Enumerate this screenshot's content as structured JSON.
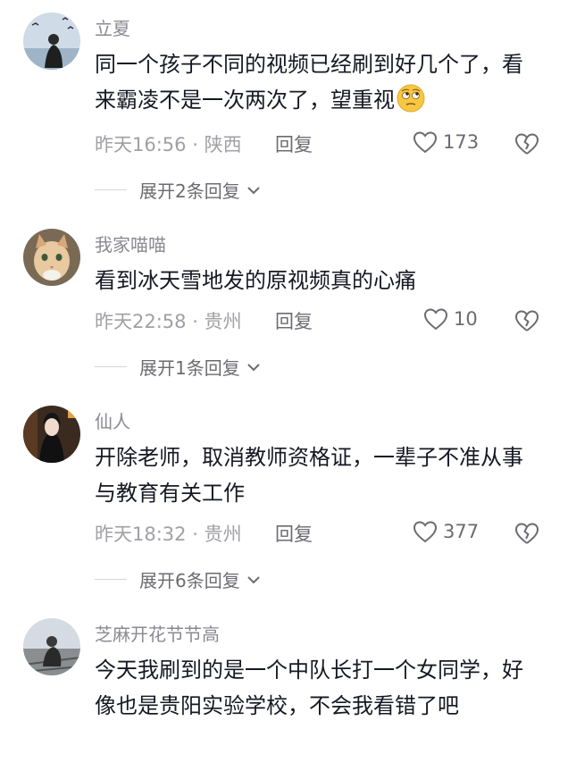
{
  "comments": [
    {
      "username": "立夏",
      "content": "同一个孩子不同的视频已经刷到好几个了，看来霸凌不是一次两次了，望重视",
      "time": "昨天16:56",
      "location": "陕西",
      "reply_label": "回复",
      "likes": "173",
      "expand_label": "展开2条回复",
      "emoji": "rolling-eyes-emoji"
    },
    {
      "username": "我家喵喵",
      "content": "看到冰天雪地发的原视频真的心痛",
      "time": "昨天22:58",
      "location": "贵州",
      "reply_label": "回复",
      "likes": "10",
      "expand_label": "展开1条回复"
    },
    {
      "username": "仙人",
      "content": "开除老师，取消教师资格证，一辈子不准从事与教育有关工作",
      "time": "昨天18:32",
      "location": "贵州",
      "reply_label": "回复",
      "likes": "377",
      "expand_label": "展开6条回复"
    },
    {
      "username": "芝麻开花节节高",
      "content": "今天我刷到的是一个中队长打一个女同学，好像也是贵阳实验学校，不会我看错了吧"
    }
  ],
  "meta_separator": "·",
  "icons": {
    "like": "heart-outline-icon",
    "dislike": "broken-heart-icon",
    "expand": "chevron-down-icon"
  },
  "colors": {
    "text_primary": "#161823",
    "text_secondary": "#8a8a92",
    "divider": "#d6d6da"
  }
}
